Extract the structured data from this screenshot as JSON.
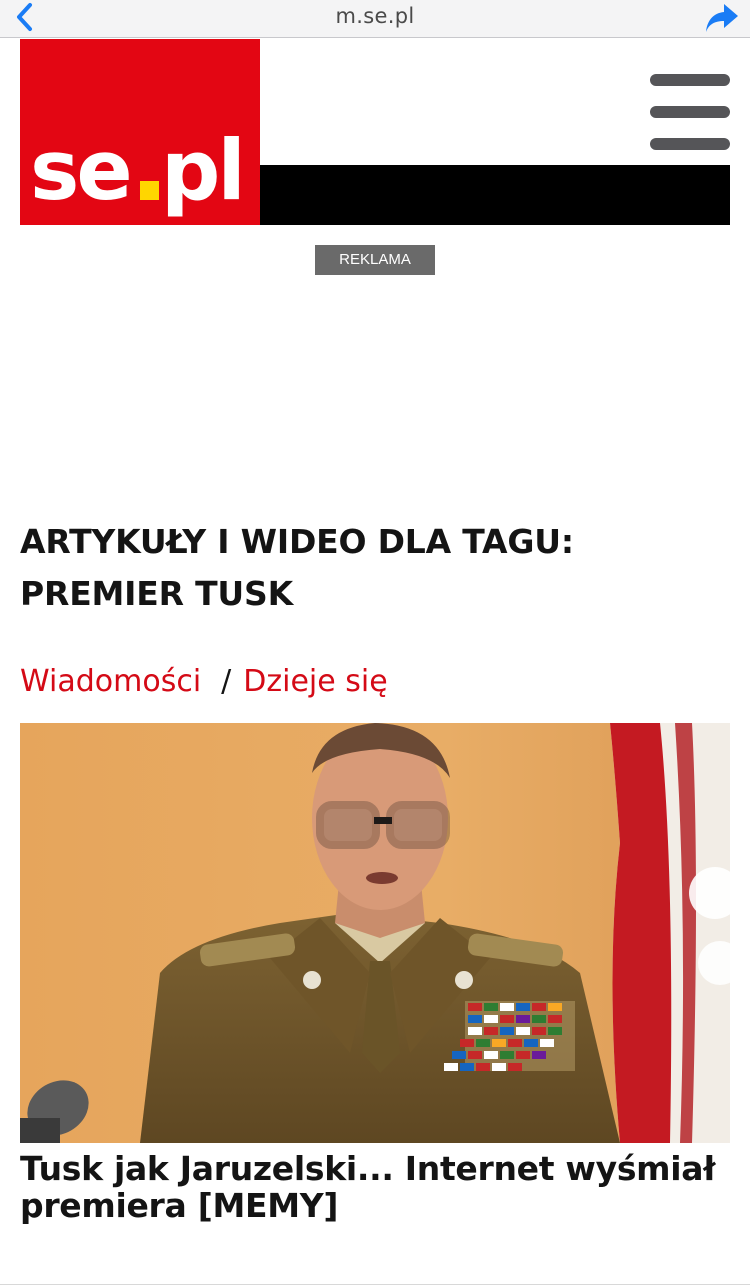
{
  "browser": {
    "url": "m.se.pl",
    "back_icon": "chevron-left-icon",
    "share_icon": "share-arrow-icon",
    "accent": "#1a7cf5"
  },
  "header": {
    "logo_text": "se.pl",
    "brand_color": "#e30613",
    "menu_icon": "hamburger-icon"
  },
  "ad": {
    "label": "REKLAMA"
  },
  "tag": {
    "heading": "ARTYKUŁY I WIDEO DLA TAGU: PREMIER TUSK"
  },
  "breadcrumb": {
    "items": [
      "Wiadomości",
      "Dzieje się"
    ],
    "separator": "/",
    "link_color": "#d40a16"
  },
  "article": {
    "title": "Tusk jak Jaruzelski... Internet wyśmiał premiera [MEMY]"
  }
}
